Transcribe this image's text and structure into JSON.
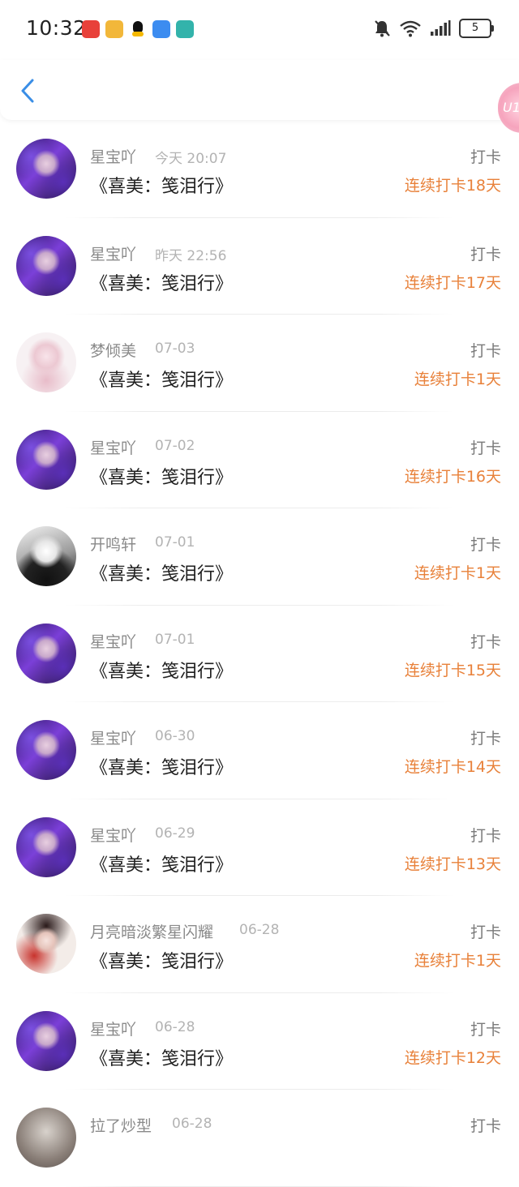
{
  "status_bar": {
    "time": "10:32",
    "battery": "5",
    "notification_icons": [
      "app-icon-red",
      "weibo-icon",
      "qq-icon",
      "message-icon",
      "shield-icon"
    ]
  },
  "header": {
    "back_icon": "chevron-left-icon",
    "accent_color": "#3a8ee6",
    "badge_text": "U1"
  },
  "colors": {
    "streak": "#e8813a",
    "username": "#8a8a8a",
    "date": "#b3b3b3"
  },
  "items": [
    {
      "user": "星宝吖",
      "date": "今天 20:07",
      "title": "《喜美：笺泪行》",
      "action": "打卡",
      "streak": "连续打卡18天"
    },
    {
      "user": "星宝吖",
      "date": "昨天 22:56",
      "title": "《喜美：笺泪行》",
      "action": "打卡",
      "streak": "连续打卡17天"
    },
    {
      "user": "梦倾美",
      "date": "07-03",
      "title": "《喜美：笺泪行》",
      "action": "打卡",
      "streak": "连续打卡1天"
    },
    {
      "user": "星宝吖",
      "date": "07-02",
      "title": "《喜美：笺泪行》",
      "action": "打卡",
      "streak": "连续打卡16天"
    },
    {
      "user": "开鸣轩",
      "date": "07-01",
      "title": "《喜美：笺泪行》",
      "action": "打卡",
      "streak": "连续打卡1天"
    },
    {
      "user": "星宝吖",
      "date": "07-01",
      "title": "《喜美：笺泪行》",
      "action": "打卡",
      "streak": "连续打卡15天"
    },
    {
      "user": "星宝吖",
      "date": "06-30",
      "title": "《喜美：笺泪行》",
      "action": "打卡",
      "streak": "连续打卡14天"
    },
    {
      "user": "星宝吖",
      "date": "06-29",
      "title": "《喜美：笺泪行》",
      "action": "打卡",
      "streak": "连续打卡13天"
    },
    {
      "user": "月亮暗淡繁星闪耀",
      "date": "06-28",
      "title": "《喜美：笺泪行》",
      "action": "打卡",
      "streak": "连续打卡1天"
    },
    {
      "user": "星宝吖",
      "date": "06-28",
      "title": "《喜美：笺泪行》",
      "action": "打卡",
      "streak": "连续打卡12天"
    },
    {
      "user": "拉了炒型",
      "date": "06-28",
      "title": "",
      "action": "打卡",
      "streak": ""
    }
  ]
}
